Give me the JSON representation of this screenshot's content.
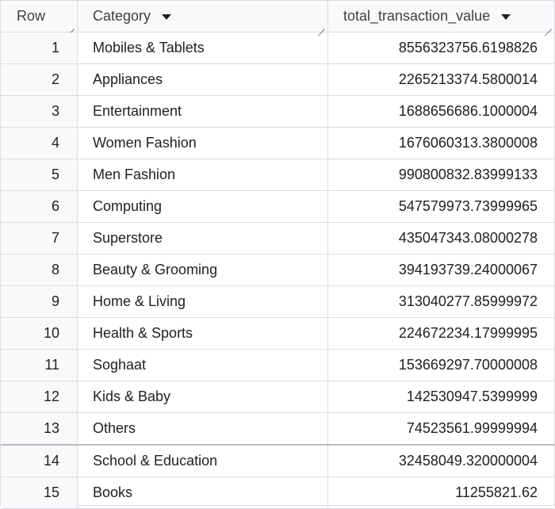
{
  "columns": {
    "row": "Row",
    "category": "Category",
    "value": "total_transaction_value"
  },
  "rows": [
    {
      "n": "1",
      "category": "Mobiles & Tablets",
      "value": "8556323756.6198826"
    },
    {
      "n": "2",
      "category": "Appliances",
      "value": "2265213374.5800014"
    },
    {
      "n": "3",
      "category": "Entertainment",
      "value": "1688656686.1000004"
    },
    {
      "n": "4",
      "category": "Women Fashion",
      "value": "1676060313.3800008"
    },
    {
      "n": "5",
      "category": "Men Fashion",
      "value": "990800832.83999133"
    },
    {
      "n": "6",
      "category": "Computing",
      "value": "547579973.73999965"
    },
    {
      "n": "7",
      "category": "Superstore",
      "value": "435047343.08000278"
    },
    {
      "n": "8",
      "category": "Beauty & Grooming",
      "value": "394193739.24000067"
    },
    {
      "n": "9",
      "category": "Home & Living",
      "value": "313040277.85999972"
    },
    {
      "n": "10",
      "category": "Health & Sports",
      "value": "224672234.17999995"
    },
    {
      "n": "11",
      "category": "Soghaat",
      "value": "153669297.70000008"
    },
    {
      "n": "12",
      "category": "Kids & Baby",
      "value": "142530947.5399999"
    },
    {
      "n": "13",
      "category": "Others",
      "value": "74523561.99999994"
    },
    {
      "n": "14",
      "category": "School & Education",
      "value": "32458049.320000004"
    },
    {
      "n": "15",
      "category": "Books",
      "value": "11255821.62"
    }
  ]
}
